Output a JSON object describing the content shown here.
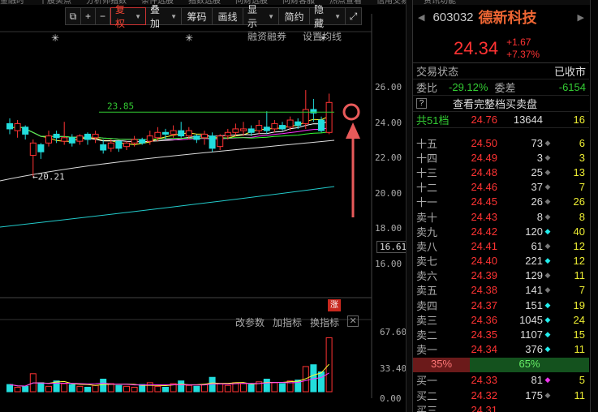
{
  "topstrip": [
    "金融时",
    "十股买点",
    "分析师指数",
    "条件选股",
    "指数选股",
    "问财选股",
    "问财客服",
    "热点查看",
    "信用交易",
    "资讯功能"
  ],
  "toolbar": {
    "items": [
      {
        "key": "window",
        "label": "⧉"
      },
      {
        "key": "plus",
        "label": "+"
      },
      {
        "key": "minus",
        "label": "−"
      },
      {
        "key": "adjust",
        "label": "复权",
        "dropdown": true
      },
      {
        "key": "overlay",
        "label": "叠加",
        "dropdown": true
      },
      {
        "key": "chips",
        "label": "筹码"
      },
      {
        "key": "draw",
        "label": "画线"
      },
      {
        "key": "display",
        "label": "显示",
        "dropdown": true
      },
      {
        "key": "simple",
        "label": "简约"
      },
      {
        "key": "hide",
        "label": "隐藏",
        "dropdown": true
      },
      {
        "key": "fullscreen",
        "label": "⤢"
      }
    ]
  },
  "chart": {
    "links": [
      "融资融券",
      "设置均线"
    ],
    "ind_links": [
      "改参数",
      "加指标",
      "换指标"
    ],
    "close": "✕",
    "price_ticks": [
      "26.00",
      "24.00",
      "22.00",
      "20.00",
      "18.00",
      "16.00"
    ],
    "current_price_label": "16.61",
    "high_label": "23.85",
    "low_label": "20.21",
    "vol_ticks": [
      "67.60",
      "33.40",
      "0.00"
    ],
    "limit_badge": "涨",
    "star": "✳"
  },
  "stock": {
    "code": "603032",
    "name": "德新科技",
    "price": "24.34",
    "change": "+1.67",
    "change_pct": "+7.37%",
    "state_label": "交易状态",
    "state_value": "已收市",
    "ratio_label": "委比",
    "ratio_value": "-29.12%",
    "diff_label": "委差",
    "diff_value": "-6154",
    "full_book_link": "查看完整档买卖盘",
    "help": "?",
    "total_row": {
      "label": "共51档",
      "price": "24.76",
      "vol": "13644",
      "cnt": "16"
    },
    "sell_levels": [
      {
        "label": "十五",
        "price": "24.50",
        "vol": "73",
        "cnt": "6",
        "dot": "◆",
        "dotc": "#777"
      },
      {
        "label": "十四",
        "price": "24.49",
        "vol": "3",
        "cnt": "3",
        "dot": "◆",
        "dotc": "#777"
      },
      {
        "label": "十三",
        "price": "24.48",
        "vol": "25",
        "cnt": "13",
        "dot": "◆",
        "dotc": "#777"
      },
      {
        "label": "十二",
        "price": "24.46",
        "vol": "37",
        "cnt": "7",
        "dot": "◆",
        "dotc": "#777"
      },
      {
        "label": "十一",
        "price": "24.45",
        "vol": "26",
        "cnt": "26",
        "dot": "◆",
        "dotc": "#777"
      },
      {
        "label": "卖十",
        "price": "24.43",
        "vol": "8",
        "cnt": "8",
        "dot": "◆",
        "dotc": "#777"
      },
      {
        "label": "卖九",
        "price": "24.42",
        "vol": "120",
        "cnt": "40",
        "dot": "◆",
        "dotc": "#2ee"
      },
      {
        "label": "卖八",
        "price": "24.41",
        "vol": "61",
        "cnt": "12",
        "dot": "◆",
        "dotc": "#777"
      },
      {
        "label": "卖七",
        "price": "24.40",
        "vol": "221",
        "cnt": "12",
        "dot": "◆",
        "dotc": "#2ee"
      },
      {
        "label": "卖六",
        "price": "24.39",
        "vol": "129",
        "cnt": "11",
        "dot": "◆",
        "dotc": "#777"
      },
      {
        "label": "卖五",
        "price": "24.38",
        "vol": "141",
        "cnt": "7",
        "dot": "◆",
        "dotc": "#777"
      },
      {
        "label": "卖四",
        "price": "24.37",
        "vol": "151",
        "cnt": "19",
        "dot": "◆",
        "dotc": "#2ee"
      },
      {
        "label": "卖三",
        "price": "24.36",
        "vol": "1045",
        "cnt": "24",
        "dot": "◆",
        "dotc": "#2ee"
      },
      {
        "label": "卖二",
        "price": "24.35",
        "vol": "1107",
        "cnt": "15",
        "dot": "◆",
        "dotc": "#2ee"
      },
      {
        "label": "卖一",
        "price": "24.34",
        "vol": "376",
        "cnt": "11",
        "dot": "◆",
        "dotc": "#2ee"
      }
    ],
    "ratio_bar": {
      "sell_pct": "35%",
      "buy_pct": "65%"
    },
    "buy_levels": [
      {
        "label": "买一",
        "price": "24.33",
        "vol": "81",
        "cnt": "5",
        "dot": "◆",
        "dotc": "#e3e"
      },
      {
        "label": "买二",
        "price": "24.32",
        "vol": "175",
        "cnt": "11",
        "dot": "◆",
        "dotc": "#777"
      },
      {
        "label": "买三",
        "price": "24.31",
        "vol": "",
        "cnt": "",
        "dot": "",
        "dotc": "#777"
      }
    ]
  },
  "colors": {
    "up": "#ff3333",
    "down": "#22dddd",
    "ma1": "#ffffff",
    "ma2": "#ffff33",
    "ma3": "#ff33ff",
    "ma4": "#33ff33",
    "ma5": "#22cccc",
    "annotation": "#e85a5a"
  },
  "candles": [
    {
      "o": 23.2,
      "c": 22.9,
      "h": 23.5,
      "l": 22.6
    },
    {
      "o": 22.8,
      "c": 23.2,
      "h": 23.4,
      "l": 22.4
    },
    {
      "o": 23.0,
      "c": 22.6,
      "h": 23.1,
      "l": 22.3
    },
    {
      "o": 21.4,
      "c": 22.1,
      "h": 22.3,
      "l": 20.2
    },
    {
      "o": 22.0,
      "c": 21.6,
      "h": 22.1,
      "l": 21.2
    },
    {
      "o": 22.1,
      "c": 22.5,
      "h": 22.8,
      "l": 21.9
    },
    {
      "o": 22.6,
      "c": 22.4,
      "h": 22.8,
      "l": 22.1
    },
    {
      "o": 22.2,
      "c": 22.4,
      "h": 23.3,
      "l": 22.0
    },
    {
      "o": 22.4,
      "c": 22.1,
      "h": 22.6,
      "l": 21.9
    },
    {
      "o": 22.2,
      "c": 22.5,
      "h": 22.6,
      "l": 22.0
    },
    {
      "o": 22.6,
      "c": 22.3,
      "h": 22.7,
      "l": 22.0
    },
    {
      "o": 22.4,
      "c": 22.6,
      "h": 22.8,
      "l": 22.1
    },
    {
      "o": 22.0,
      "c": 21.7,
      "h": 22.3,
      "l": 21.5
    },
    {
      "o": 21.8,
      "c": 22.1,
      "h": 22.3,
      "l": 21.6
    },
    {
      "o": 22.2,
      "c": 21.8,
      "h": 22.2,
      "l": 21.6
    },
    {
      "o": 21.9,
      "c": 22.1,
      "h": 22.2,
      "l": 21.7
    },
    {
      "o": 22.1,
      "c": 22.3,
      "h": 22.5,
      "l": 21.9
    },
    {
      "o": 22.3,
      "c": 22.1,
      "h": 22.4,
      "l": 22.0
    },
    {
      "o": 22.2,
      "c": 22.5,
      "h": 22.8,
      "l": 22.0
    },
    {
      "o": 22.4,
      "c": 22.7,
      "h": 23.0,
      "l": 22.2
    },
    {
      "o": 22.7,
      "c": 22.6,
      "h": 22.9,
      "l": 22.3
    },
    {
      "o": 22.6,
      "c": 22.8,
      "h": 23.1,
      "l": 22.4
    },
    {
      "o": 22.8,
      "c": 22.5,
      "h": 23.3,
      "l": 22.4
    },
    {
      "o": 22.5,
      "c": 22.8,
      "h": 23.0,
      "l": 22.3
    },
    {
      "o": 22.5,
      "c": 22.3,
      "h": 22.6,
      "l": 22.1
    },
    {
      "o": 22.4,
      "c": 22.6,
      "h": 22.8,
      "l": 22.0
    },
    {
      "o": 22.5,
      "c": 21.8,
      "h": 22.7,
      "l": 21.6
    },
    {
      "o": 21.9,
      "c": 22.5,
      "h": 22.6,
      "l": 21.7
    },
    {
      "o": 22.5,
      "c": 22.7,
      "h": 22.9,
      "l": 22.3
    },
    {
      "o": 22.7,
      "c": 22.9,
      "h": 23.2,
      "l": 22.5
    },
    {
      "o": 22.8,
      "c": 22.9,
      "h": 23.3,
      "l": 22.5
    },
    {
      "o": 22.9,
      "c": 22.7,
      "h": 23.1,
      "l": 22.5
    },
    {
      "o": 22.8,
      "c": 23.1,
      "h": 23.4,
      "l": 22.6
    },
    {
      "o": 23.0,
      "c": 22.8,
      "h": 23.9,
      "l": 22.6
    },
    {
      "o": 22.9,
      "c": 23.2,
      "h": 23.4,
      "l": 22.7
    },
    {
      "o": 23.1,
      "c": 22.9,
      "h": 23.3,
      "l": 22.8
    },
    {
      "o": 23.0,
      "c": 23.4,
      "h": 23.6,
      "l": 22.8
    },
    {
      "o": 23.3,
      "c": 23.1,
      "h": 23.5,
      "l": 22.9
    },
    {
      "o": 23.2,
      "c": 24.0,
      "h": 25.1,
      "l": 22.9
    },
    {
      "o": 24.0,
      "c": 23.8,
      "h": 24.6,
      "l": 23.3
    },
    {
      "o": 23.4,
      "c": 22.8,
      "h": 23.6,
      "l": 22.7
    },
    {
      "o": 22.7,
      "c": 24.4,
      "h": 24.9,
      "l": 22.6
    }
  ],
  "volumes": [
    8,
    5,
    6,
    20,
    10,
    6,
    12,
    9,
    8,
    6,
    5,
    7,
    14,
    9,
    7,
    6,
    5,
    8,
    10,
    6,
    5,
    9,
    12,
    7,
    6,
    8,
    16,
    9,
    7,
    10,
    9,
    8,
    11,
    14,
    10,
    9,
    12,
    13,
    28,
    30,
    22,
    60
  ]
}
